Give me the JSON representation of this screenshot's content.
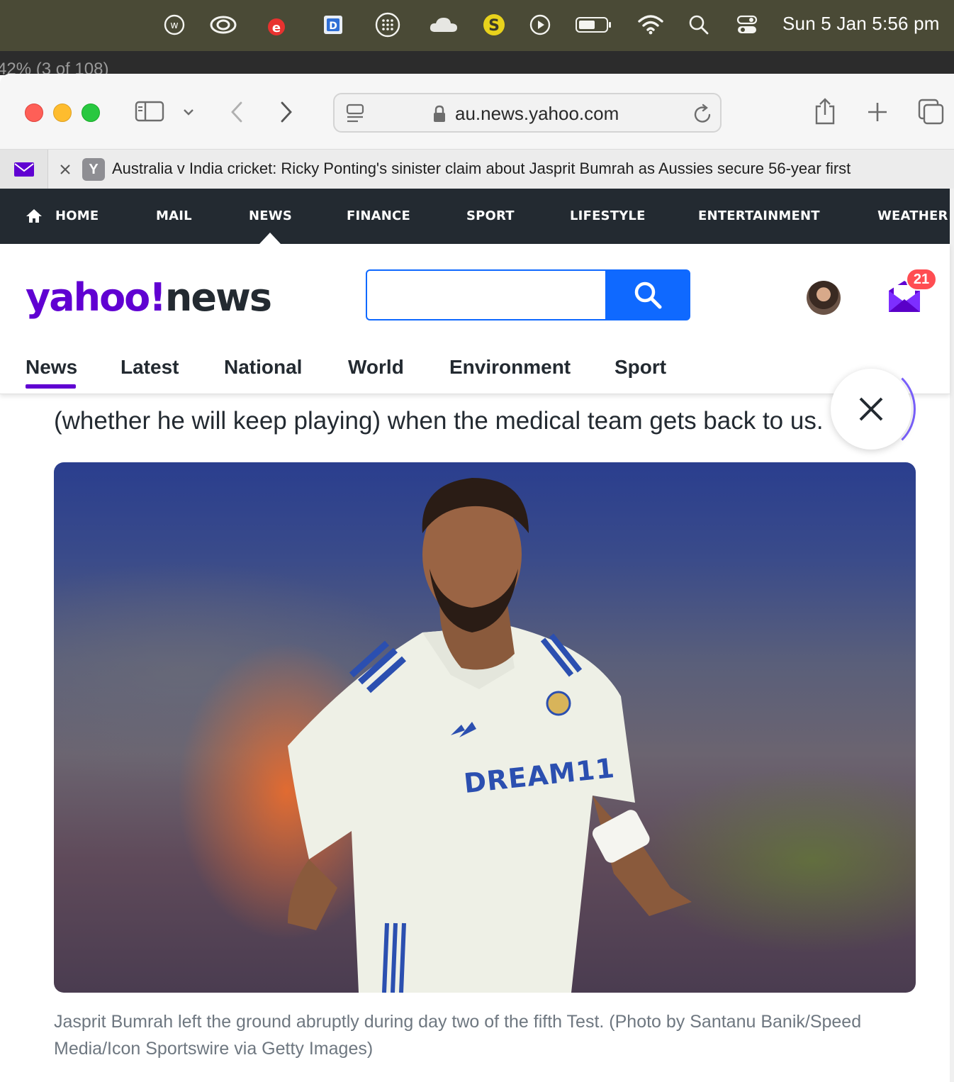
{
  "menubar": {
    "icons": [
      "wunderbucket-icon",
      "creative-cloud-icon",
      "antivirus-icon",
      "dictionary-icon",
      "dots-grid-icon",
      "cloud-icon",
      "skype-icon",
      "play-icon",
      "battery-icon",
      "wifi-icon",
      "spotlight-icon",
      "control-center-icon"
    ],
    "clock": "Sun 5 Jan  5:56 pm"
  },
  "behind_window": {
    "text": "42% (3 of 108)"
  },
  "browser": {
    "url": "au.news.yahoo.com",
    "tab": {
      "favicon": "Y",
      "title": "Australia v India cricket: Ricky Ponting's sinister claim about Jasprit Bumrah as Aussies secure 56-year first"
    }
  },
  "yahoo_nav": {
    "items": [
      "HOME",
      "MAIL",
      "NEWS",
      "FINANCE",
      "SPORT",
      "LIFESTYLE",
      "ENTERTAINMENT",
      "WEATHER"
    ],
    "active": "NEWS"
  },
  "header": {
    "logo_yahoo": "yahoo!",
    "logo_news": "news",
    "search_placeholder": "",
    "mail_count": "21"
  },
  "subnav": {
    "items": [
      "News",
      "Latest",
      "National",
      "World",
      "Environment",
      "Sport"
    ],
    "active": "News"
  },
  "article": {
    "text_line": "(whether he will keep playing) when the medical team gets back to us.",
    "image_caption": "Jasprit Bumrah left the ground abruptly during day two of the fifth Test. (Photo by Santanu Banik/Speed Media/Icon Sportswire via Getty Images)",
    "jersey_text": "DREAM11"
  },
  "colors": {
    "yahoo_purple": "#6001d2",
    "nav_dark": "#232a31",
    "search_blue": "#0f69ff",
    "badge_red": "#ff4d52"
  }
}
